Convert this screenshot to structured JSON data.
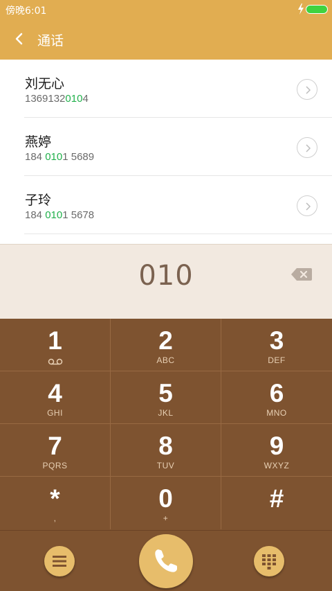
{
  "status_bar": {
    "time": "傍晚6:01"
  },
  "header": {
    "title": "通话"
  },
  "contacts": [
    {
      "name": "刘无心",
      "number_pre": "1369132",
      "number_match": "010",
      "number_post": "4"
    },
    {
      "name": "燕婷",
      "number_pre": "184 ",
      "number_match": "010",
      "number_post": "1 5689"
    },
    {
      "name": "子玲",
      "number_pre": "184 ",
      "number_match": "010",
      "number_post": "1 5678"
    }
  ],
  "dialer": {
    "input_value": "010"
  },
  "keys": [
    {
      "digit": "1",
      "letters": ""
    },
    {
      "digit": "2",
      "letters": "ABC"
    },
    {
      "digit": "3",
      "letters": "DEF"
    },
    {
      "digit": "4",
      "letters": "GHI"
    },
    {
      "digit": "5",
      "letters": "JKL"
    },
    {
      "digit": "6",
      "letters": "MNO"
    },
    {
      "digit": "7",
      "letters": "PQRS"
    },
    {
      "digit": "8",
      "letters": "TUV"
    },
    {
      "digit": "9",
      "letters": "WXYZ"
    },
    {
      "digit": "*",
      "letters": ","
    },
    {
      "digit": "0",
      "letters": "+"
    },
    {
      "digit": "#",
      "letters": ""
    }
  ],
  "colors": {
    "header_bg": "#e1ad51",
    "match_highlight": "#22b14c",
    "keypad_bg": "#7e5330",
    "action_button": "#e7bd6b"
  },
  "icons": [
    "back-arrow-icon",
    "chevron-right-icon",
    "backspace-icon",
    "voicemail-icon",
    "menu-icon",
    "phone-icon",
    "dialpad-icon",
    "charging-icon",
    "battery-icon"
  ]
}
